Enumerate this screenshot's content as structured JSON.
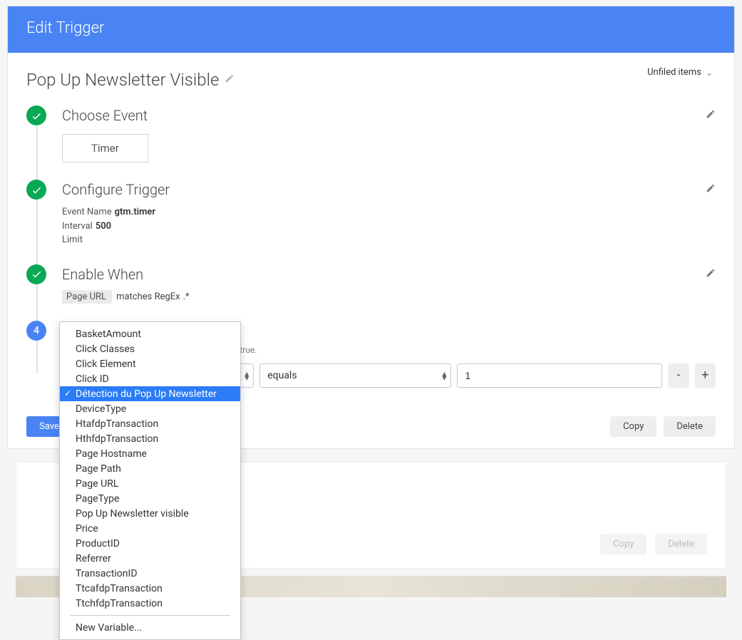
{
  "header": {
    "title": "Edit Trigger"
  },
  "trigger": {
    "name": "Pop Up Newsletter Visible",
    "folder_label": "Unfiled items"
  },
  "steps": {
    "choose_event": {
      "title": "Choose Event",
      "chip": "Timer"
    },
    "configure": {
      "title": "Configure Trigger",
      "rows": {
        "event_name_label": "Event Name",
        "event_name_value": "gtm.timer",
        "interval_label": "Interval",
        "interval_value": "500",
        "limit_label": "Limit",
        "limit_value": ""
      }
    },
    "enable_when": {
      "title": "Enable When",
      "variable": "Page URL",
      "operator": "matches RegEx",
      "value": ".*"
    },
    "fire": {
      "number": "4",
      "hint_suffix": "e true.",
      "operator": "equals",
      "value": "1"
    }
  },
  "dropdown": {
    "items": [
      "BasketAmount",
      "Click Classes",
      "Click Element",
      "Click ID",
      "Détection du Pop Up Newsletter",
      "DeviceType",
      "HtafdpTransaction",
      "HthfdpTransaction",
      "Page Hostname",
      "Page Path",
      "Page URL",
      "PageType",
      "Pop Up Newsletter visible",
      "Price",
      "ProductID",
      "Referrer",
      "TransactionID",
      "TtcafdpTransaction",
      "TtchfdpTransaction"
    ],
    "selected_index": 4,
    "new_label": "New Variable..."
  },
  "buttons": {
    "save": "Save Trigger",
    "copy": "Copy",
    "delete": "Delete",
    "minus": "-",
    "plus": "+"
  }
}
